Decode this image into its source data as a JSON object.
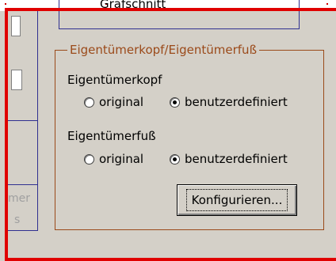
{
  "top_group": {
    "label": "Grafschnitt"
  },
  "left_panel": {
    "fragment_1": "mer",
    "fragment_2": "s"
  },
  "owner_group": {
    "legend": "Eigentümerkopf/Eigentümerfuß",
    "kopf": {
      "label": "Eigentümerkopf",
      "options": [
        {
          "label": "original",
          "checked": false
        },
        {
          "label": "benutzerdefiniert",
          "checked": true
        }
      ]
    },
    "fuss": {
      "label": "Eigentümerfuß",
      "options": [
        {
          "label": "original",
          "checked": false
        },
        {
          "label": "benutzerdefiniert",
          "checked": true
        }
      ]
    },
    "configure_button": "Konfigurieren..."
  },
  "colors": {
    "background": "#d4d0c8",
    "legend": "#9b4a1a",
    "selection_frame": "#e00000",
    "group_border": "#303090"
  }
}
